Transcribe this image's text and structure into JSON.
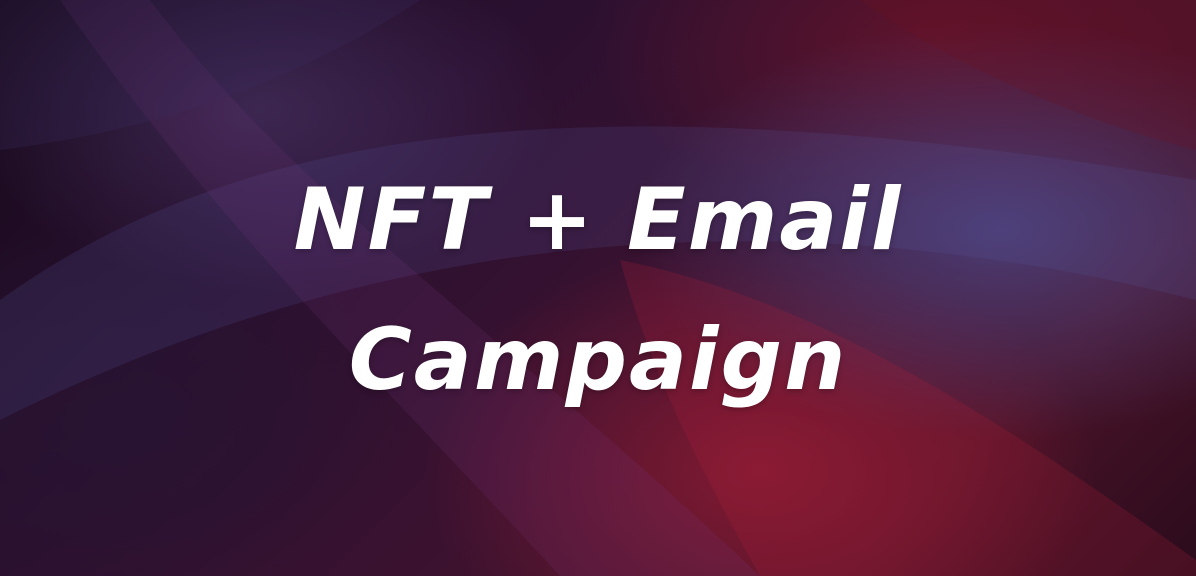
{
  "banner": {
    "title_line1": "NFT + Email",
    "title_line2": "Campaign"
  },
  "colors": {
    "text": "#ffffff",
    "background_dark": "#16091a",
    "accent_red": "#961c34",
    "accent_blue": "#4e4a8c"
  }
}
